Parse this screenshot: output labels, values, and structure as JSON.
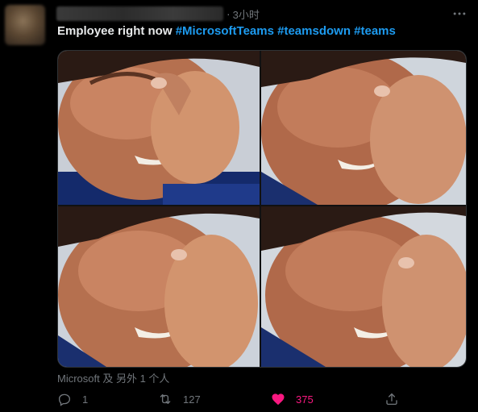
{
  "tweet": {
    "time": "3小时",
    "separator": "·",
    "text": {
      "plain": "Employee right now ",
      "hashtags": [
        "#MicrosoftTeams",
        "#teamsdown",
        "#teams"
      ]
    },
    "mentions": "Microsoft 及 另外 1 个人",
    "actions": {
      "replies": "1",
      "retweets": "127",
      "likes": "375"
    }
  },
  "colors": {
    "background": "#000000",
    "text": "#e7e9ea",
    "secondary": "#71767b",
    "link": "#1d9bf0",
    "like": "#f91880"
  },
  "icons": {
    "more": "more-dots-icon",
    "reply": "reply-icon",
    "retweet": "retweet-icon",
    "like": "heart-filled-icon",
    "share": "share-icon"
  }
}
